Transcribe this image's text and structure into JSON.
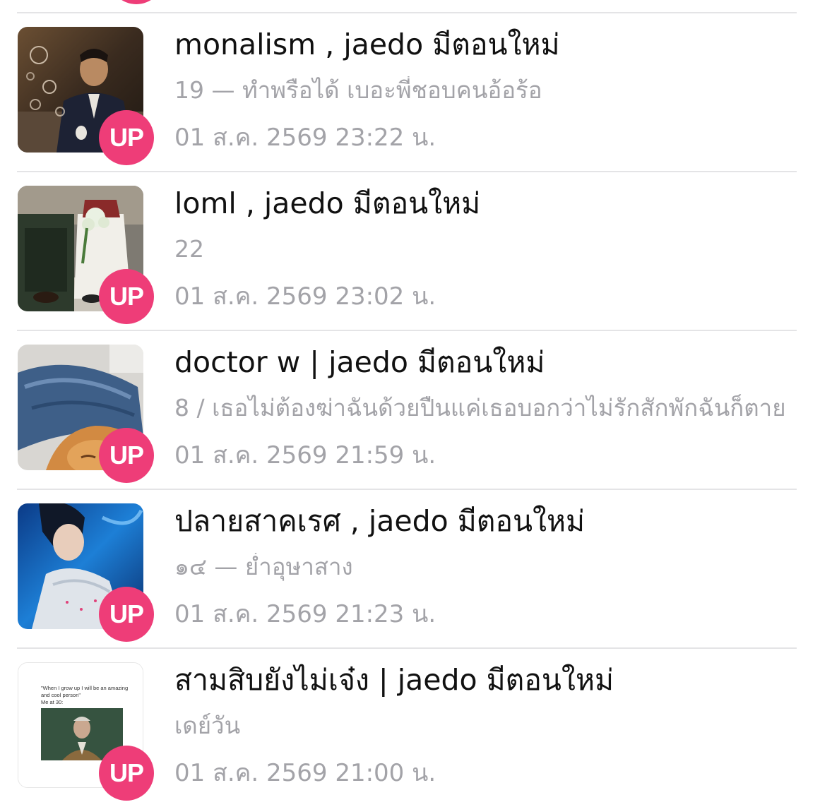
{
  "colors": {
    "badge": "#ee3d78",
    "title": "#111111",
    "meta": "#a3a3a8",
    "divider": "#e4e4e6"
  },
  "badge_label": "UP",
  "stories": [
    {
      "title": "monalism , jaedo  มีตอนใหม่",
      "subtitle": "19 — ทำพรือได้ เบอะพี่ชอบคนอ้อร้อ",
      "date": "01 ส.ค. 2569 23:22 น."
    },
    {
      "title": "loml , jaedo มีตอนใหม่",
      "subtitle": "22",
      "date": "01 ส.ค. 2569 23:02 น."
    },
    {
      "title": "doctor w | jaedo มีตอนใหม่",
      "subtitle": "8 / เธอไม่ต้องฆ่าฉันด้วยปืนแค่เธอบอกว่าไม่รักสักพักฉันก็ตาย",
      "date": "01 ส.ค. 2569 21:59 น."
    },
    {
      "title": "ปลายสาคเรศ , jaedo มีตอนใหม่",
      "subtitle": "๑๔ — ย่ำอุษาสาง",
      "date": "01 ส.ค. 2569 21:23 น."
    },
    {
      "title": "สามสิบยังไม่เจ๋ง | jaedo มีตอนใหม่",
      "subtitle": "เดย์วัน",
      "date": "01 ส.ค. 2569 21:00 น.",
      "thumb_text": {
        "quote_line1": "\"When I grow up I will be an amazing",
        "quote_line2": "and cool person\"",
        "quote_line3": "Me at 30:"
      }
    }
  ]
}
